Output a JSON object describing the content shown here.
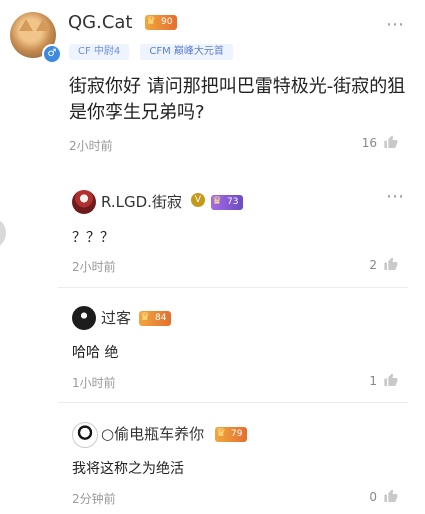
{
  "main_comment": {
    "username": "QG.Cat",
    "level": "90",
    "tags": [
      "CF 中尉4",
      "CFM 巅峰大元首"
    ],
    "content": "街寂你好 请问那把叫巴雷特极光-街寂的狙是你孪生兄弟吗?",
    "time": "2小时前",
    "likes": "16",
    "more_icon": "ellipsis-icon"
  },
  "replies": [
    {
      "username": "R.LGD.街寂",
      "verified": "V",
      "level": "73",
      "content": "？？？",
      "time": "2小时前",
      "likes": "2"
    },
    {
      "username": "过客",
      "level": "84",
      "content": "哈哈  绝",
      "time": "1小时前",
      "likes": "1"
    },
    {
      "username": "○偷电瓶车养你",
      "level": "79",
      "content": "我将这称之为绝活",
      "time": "2分钟前",
      "likes": "0"
    }
  ]
}
